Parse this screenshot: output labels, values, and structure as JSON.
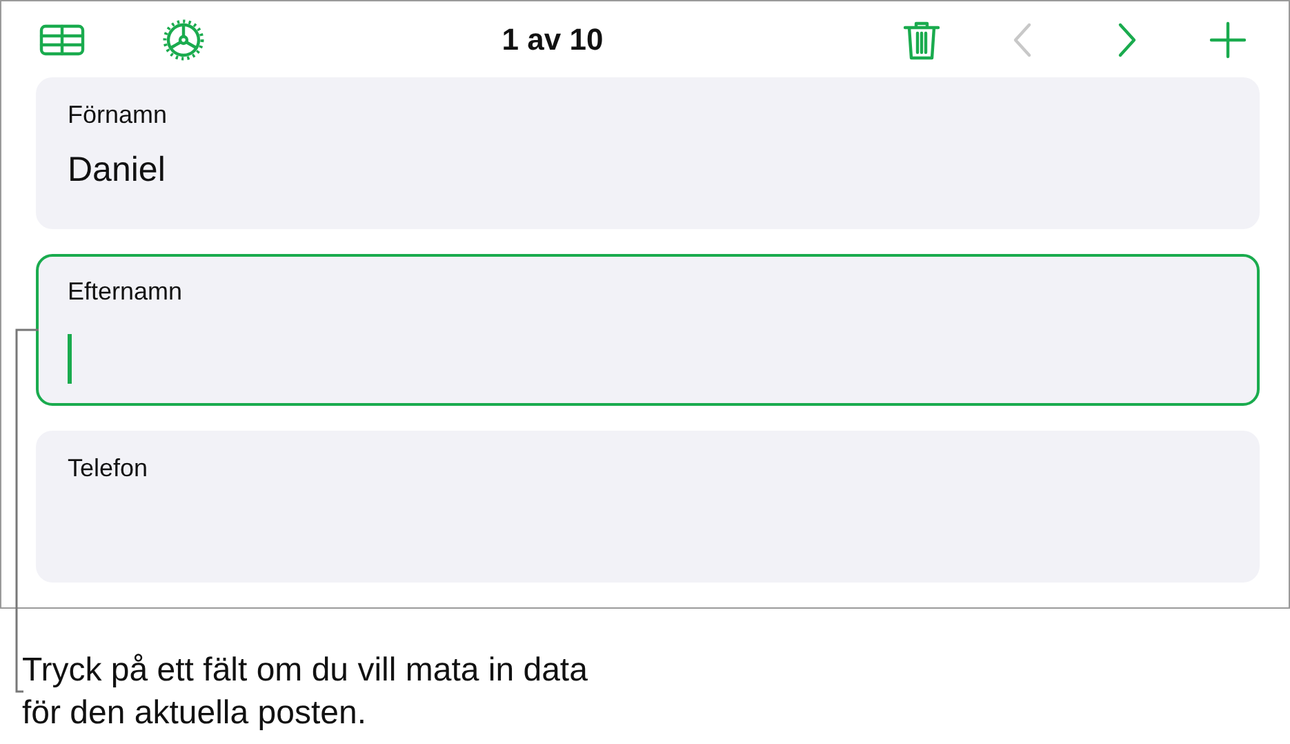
{
  "toolbar": {
    "left_buttons": [
      {
        "kind": "table",
        "disabled": false
      },
      {
        "kind": "gear",
        "disabled": false
      }
    ],
    "title": "1 av 10",
    "right_buttons": [
      {
        "kind": "trash",
        "disabled": false
      },
      {
        "kind": "previous",
        "disabled": true
      },
      {
        "kind": "next",
        "disabled": false
      },
      {
        "kind": "add",
        "disabled": false
      }
    ]
  },
  "fields": [
    {
      "label": "Förnamn",
      "value": "Daniel",
      "selected": false
    },
    {
      "label": "Efternamn",
      "selected": true
    },
    {
      "label": "Telefon",
      "selected": false
    }
  ],
  "callout": "Tryck på ett fält om du vill mata in data för den aktuella posten."
}
